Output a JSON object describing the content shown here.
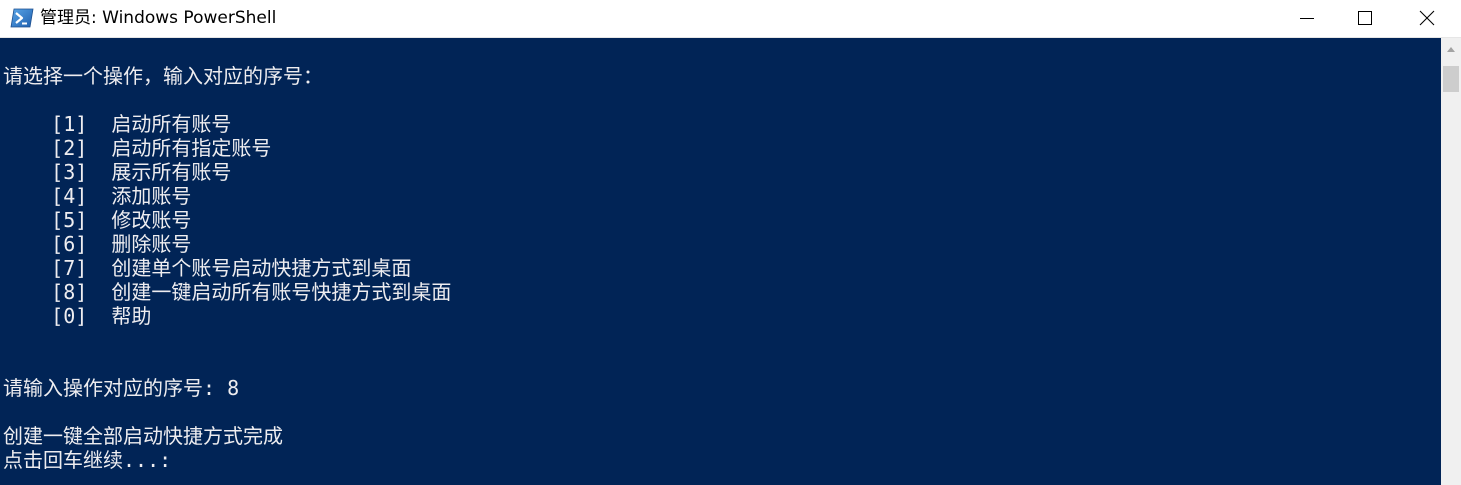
{
  "window": {
    "title": "管理员: Windows PowerShell",
    "icon": "powershell-icon",
    "minimize_icon": "minimize-icon",
    "maximize_icon": "maximize-icon",
    "close_icon": "close-icon"
  },
  "console": {
    "background": "#012456",
    "foreground": "#eeedf0",
    "lines": [
      "请选择一个操作，输入对应的序号：",
      "",
      "    [1]  启动所有账号",
      "    [2]  启动所有指定账号",
      "    [3]  展示所有账号",
      "    [4]  添加账号",
      "    [5]  修改账号",
      "    [6]  删除账号",
      "    [7]  创建单个账号启动快捷方式到桌面",
      "    [8]  创建一键启动所有账号快捷方式到桌面",
      "    [0]  帮助",
      "",
      "",
      "请输入操作对应的序号: 8",
      "",
      "创建一键全部启动快捷方式完成",
      "点击回车继续...:"
    ]
  },
  "scrollbar": {
    "up_icon": "scroll-up-arrow-icon"
  }
}
